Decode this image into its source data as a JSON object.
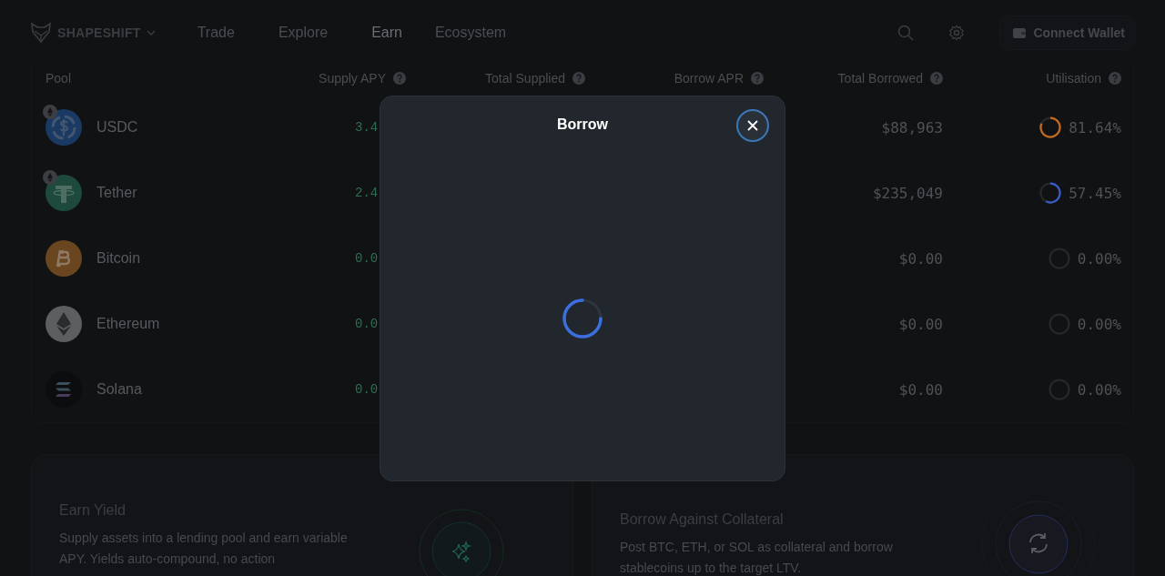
{
  "nav": {
    "brand": "SHAPESHIFT",
    "links": [
      {
        "label": "Trade",
        "selected": false
      },
      {
        "label": "Explore",
        "selected": false
      },
      {
        "label": "Earn",
        "selected": true
      },
      {
        "label": "Ecosystem",
        "selected": false
      }
    ],
    "connect_button": "Connect Wallet"
  },
  "table": {
    "columns": [
      "Pool",
      "Supply APY",
      "Total Supplied",
      "Borrow APR",
      "Total Borrowed",
      "Utilisation"
    ],
    "rows": [
      {
        "kind": "usdc",
        "network_badge": true,
        "name": "USDC",
        "supply_apy": "3.4",
        "total_borrowed": "$88,963",
        "utilisation": "81.64%",
        "level": 0.8164,
        "color": "#c26a1e"
      },
      {
        "kind": "tether",
        "network_badge": true,
        "name": "Tether",
        "supply_apy": "2.4",
        "total_borrowed": "$235,049",
        "utilisation": "57.45%",
        "level": 0.5745,
        "color": "#3a5bc7"
      },
      {
        "kind": "bitcoin",
        "network_badge": false,
        "name": "Bitcoin",
        "supply_apy": "0.0",
        "total_borrowed": "$0.00",
        "utilisation": "0.00%"
      },
      {
        "kind": "ethereum",
        "network_badge": false,
        "name": "Ethereum",
        "supply_apy": "0.0",
        "total_borrowed": "$0.00",
        "utilisation": "0.00%"
      },
      {
        "kind": "solana",
        "network_badge": false,
        "name": "Solana",
        "supply_apy": "0.0",
        "total_borrowed": "$0.00",
        "utilisation": "0.00%"
      }
    ]
  },
  "cards": [
    {
      "kind": "earn",
      "title": "Earn Yield",
      "text": "Supply assets into a lending pool and earn variable APY. Yields auto-compound, no action"
    },
    {
      "kind": "borrow",
      "title": "Borrow Against Collateral",
      "text": "Post BTC, ETH, or SOL as collateral and borrow stablecoins up to the target LTV."
    }
  ],
  "modal": {
    "title": "Borrow",
    "loading": true
  }
}
